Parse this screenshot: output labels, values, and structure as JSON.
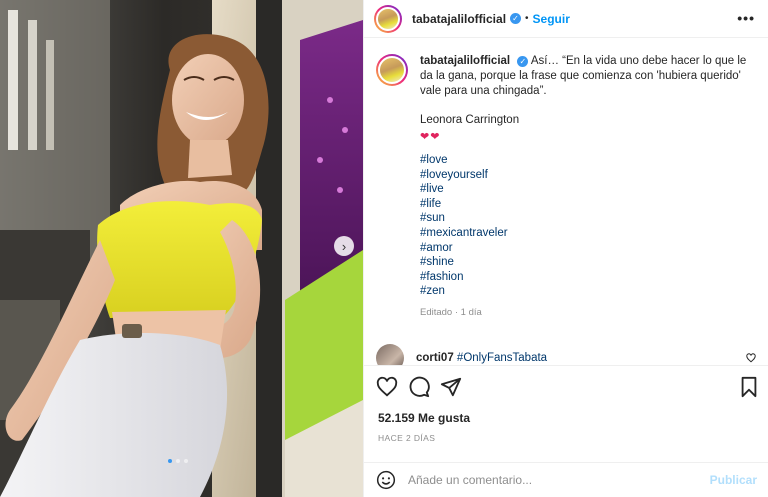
{
  "post": {
    "username": "tabatajalilofficial",
    "follow_label": "Seguir",
    "separator": "•",
    "more_label": "•••",
    "verified_mark": "✓"
  },
  "caption": {
    "username": "tabatajalilofficial",
    "text": "Así… “En la vida uno debe hacer lo que le da la gana, porque la frase que comienza con 'hubiera querido' vale para una chingada”.",
    "author": "Leonora Carrington",
    "hearts": "❤❤",
    "hashtags": [
      "#love",
      "#loveyourself",
      "#live",
      "#life",
      "#sun",
      "#mexicantraveler",
      "#amor",
      "#shine",
      "#fashion",
      "#zen"
    ],
    "edited": "Editado · 1 día"
  },
  "comment": {
    "username": "corti07",
    "mention": "#OnlyFansTabata"
  },
  "stats": {
    "likes": "52.159 Me gusta",
    "time_ago": "HACE 2 DÍAS"
  },
  "composer": {
    "placeholder": "Añade un comentario...",
    "publish_label": "Publicar"
  },
  "carousel": {
    "next_arrow": "›",
    "slide_count": 3,
    "active_slide": 1
  },
  "colors": {
    "accent_blue": "#0095f6",
    "hashtag_blue": "#00376b",
    "publish_disabled": "#b2dffc",
    "heart_red": "#e0245e"
  }
}
